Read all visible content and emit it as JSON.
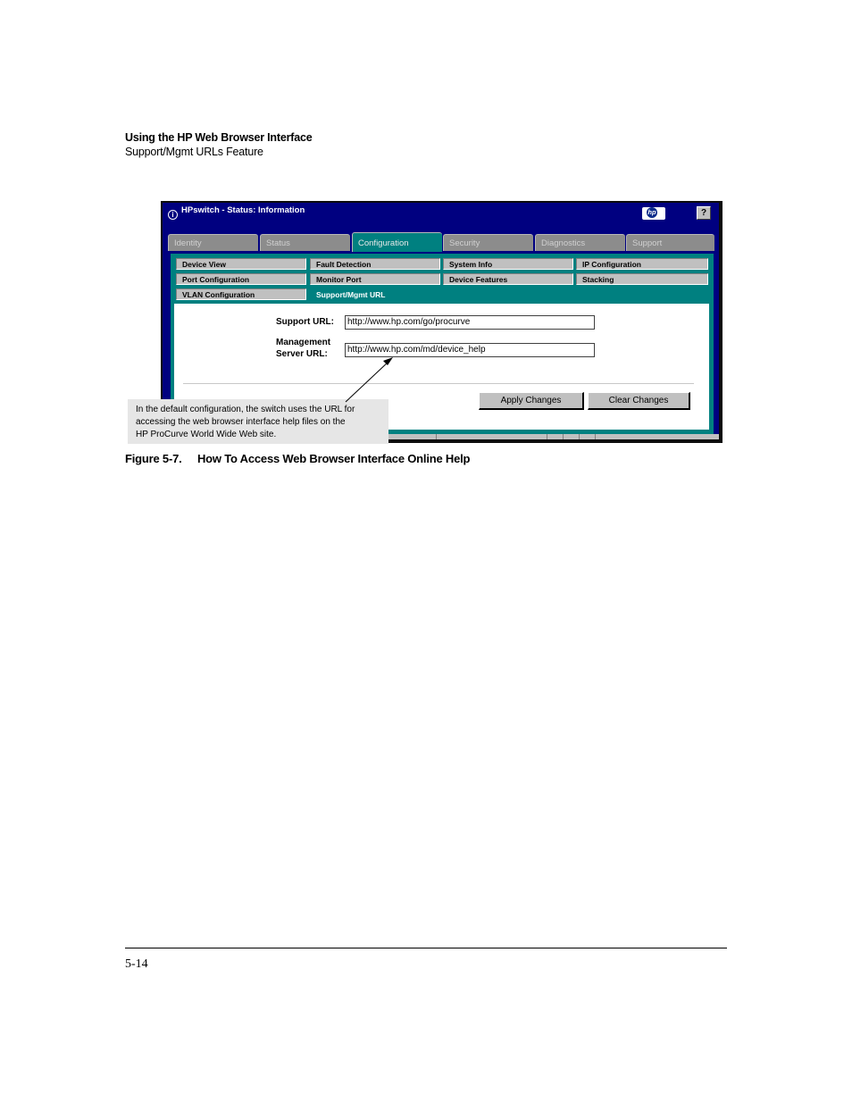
{
  "header": {
    "title": "Using the HP Web Browser Interface",
    "subtitle": "Support/Mgmt URLs Feature"
  },
  "screenshot": {
    "window_title": "HPswitch - Status: Information",
    "help_label": "?",
    "logo_text": "hp",
    "tabs": [
      "Identity",
      "Status",
      "Configuration",
      "Security",
      "Diagnostics",
      "Support"
    ],
    "active_tab": "Configuration",
    "subtabs": [
      "Device View",
      "Fault Detection",
      "System Info",
      "IP Configuration",
      "Port Configuration",
      "Monitor Port",
      "Device Features",
      "Stacking",
      "VLAN Configuration",
      "Support/Mgmt URL"
    ],
    "active_subtab": "Support/Mgmt URL",
    "form": {
      "support_label": "Support URL:",
      "support_value": "http://www.hp.com/go/procurve",
      "mgmt_label_line1": "Management",
      "mgmt_label_line2": "Server URL:",
      "mgmt_value": "http://www.hp.com/md/device_help"
    },
    "buttons": {
      "apply": "Apply Changes",
      "clear": "Clear Changes"
    }
  },
  "callout": {
    "line1": "In the default configuration, the switch uses the URL for",
    "line2": "accessing the web browser interface help files on the",
    "line3": "HP ProCurve  World Wide Web site."
  },
  "caption": {
    "number": "Figure 5-7.",
    "text": "How To Access Web Browser Interface Online Help"
  },
  "footer": {
    "page_number": "5-14"
  },
  "colors": {
    "window_bg": "#000080",
    "panel_teal": "#008080",
    "tab_gray": "#8c8c8c",
    "button_gray": "#c0c0c0"
  }
}
